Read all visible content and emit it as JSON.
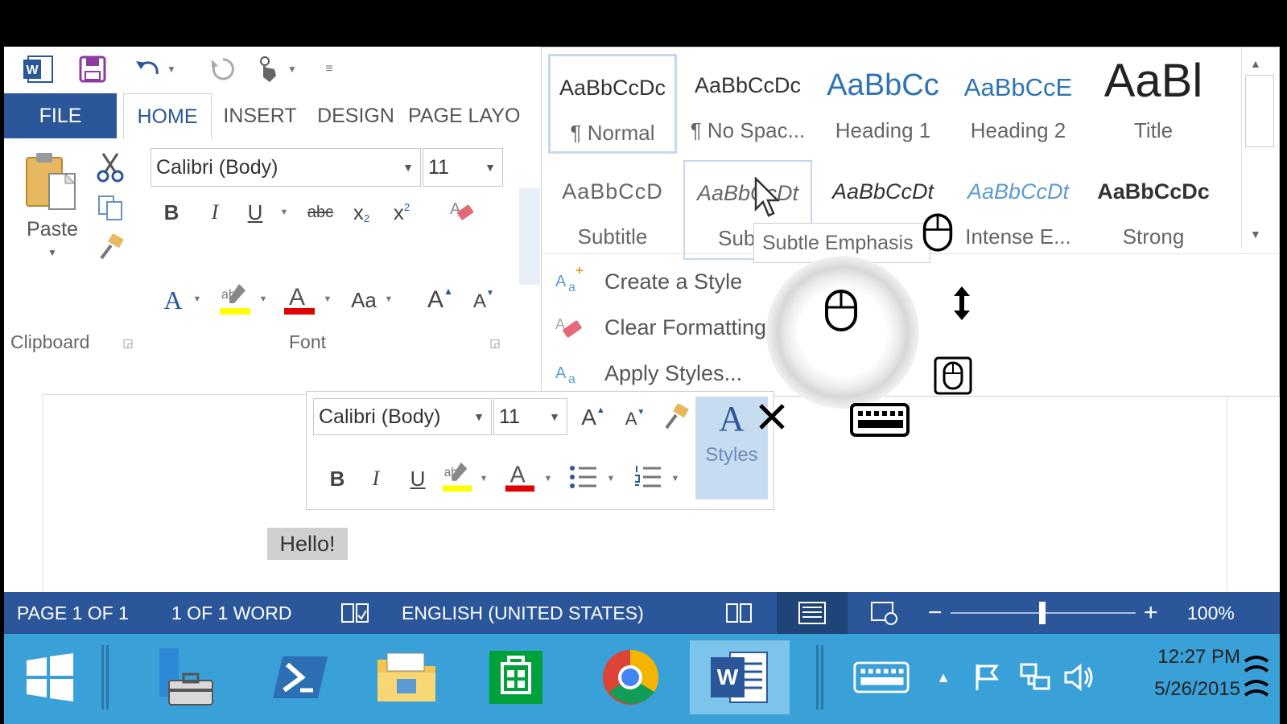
{
  "tabs": {
    "file": "FILE",
    "home": "HOME",
    "insert": "INSERT",
    "design": "DESIGN",
    "page_layout": "PAGE LAYO"
  },
  "ribbon": {
    "clipboard": {
      "paste": "Paste",
      "label": "Clipboard"
    },
    "font": {
      "family": "Calibri (Body)",
      "size": "11",
      "label": "Font",
      "case": "Aa"
    }
  },
  "styles_gallery": {
    "row1": [
      {
        "preview": "AaBbCcDc",
        "name": "¶ Normal"
      },
      {
        "preview": "AaBbCcDc",
        "name": "¶ No Spac..."
      },
      {
        "preview": "AaBbCc",
        "name": "Heading 1"
      },
      {
        "preview": "AaBbCcE",
        "name": "Heading 2"
      },
      {
        "preview": "AaBl",
        "name": "Title"
      }
    ],
    "row2": [
      {
        "preview": "AaBbCcD",
        "name": "Subtitle"
      },
      {
        "preview": "AaBbCcDt",
        "name": "Subtle"
      },
      {
        "preview": "AaBbCcDt",
        "name": ""
      },
      {
        "preview": "AaBbCcDt",
        "name": "Intense E..."
      },
      {
        "preview": "AaBbCcDc",
        "name": "Strong"
      }
    ],
    "menu": [
      "Create a Style",
      "Clear Formatting",
      "Apply Styles..."
    ],
    "tooltip": "Subtle Emphasis"
  },
  "mini_toolbar": {
    "font": "Calibri (Body)",
    "size": "11",
    "styles": "Styles"
  },
  "document": {
    "selected_text": "Hello!"
  },
  "status_bar": {
    "page": "PAGE 1 OF 1",
    "words": "1 OF 1 WORD",
    "language": "ENGLISH (UNITED STATES)",
    "zoom": "100%",
    "zoom_minus": "−",
    "zoom_plus": "+"
  },
  "taskbar": {
    "time": "12:27 PM",
    "date": "5/26/2015"
  },
  "colors": {
    "accent": "#2b579a",
    "taskbar": "#3aa0d8",
    "highlight": "#ffff00",
    "font_color": "#e00000"
  }
}
